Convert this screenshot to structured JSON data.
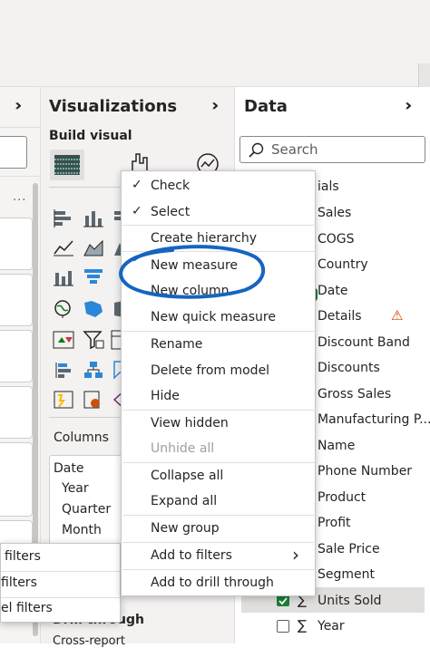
{
  "filters_pane": {
    "collapse_icon": "double-chevron-right-icon",
    "more_label": "...",
    "filter_labels": [
      "filters",
      "filters",
      "el filters"
    ]
  },
  "visualizations": {
    "title": "Visualizations",
    "expand_icon": "double-chevron-right-icon",
    "build_visual_label": "Build visual",
    "columns_label": "Columns",
    "date_field": "Date",
    "date_parts": [
      "Year",
      "Quarter",
      "Month"
    ],
    "drill_through_label": "Drill through",
    "cross_report_label": "Cross-report"
  },
  "data_pane": {
    "title": "Data",
    "expand_icon": "double-chevron-right-icon",
    "search_placeholder": "Search",
    "table_name_partial": "ials",
    "fields": [
      {
        "label": "Sales"
      },
      {
        "label": "COGS"
      },
      {
        "label": "Country"
      },
      {
        "label": "Date"
      },
      {
        "label": "Details",
        "warning": true
      },
      {
        "label": "Discount Band"
      },
      {
        "label": "Discounts"
      },
      {
        "label": "Gross Sales"
      },
      {
        "label": "Manufacturing P..."
      },
      {
        "label": "Name"
      },
      {
        "label": "Phone Number"
      },
      {
        "label": "Product"
      },
      {
        "label": "Profit"
      },
      {
        "label": "Sale Price"
      },
      {
        "label": "Segment"
      },
      {
        "label": "Units Sold",
        "checked": true,
        "sigma": true
      },
      {
        "label": "Year",
        "checked": false,
        "sigma": true
      }
    ],
    "warning_glyph": "⚠",
    "sigma_glyph": "∑"
  },
  "context_menu": {
    "check_glyph": "✓",
    "submenu_glyph": "›",
    "items": [
      "Check",
      "Select",
      "Create hierarchy",
      "New measure",
      "New column",
      "New quick measure",
      "Rename",
      "Delete from model",
      "Hide",
      "View hidden",
      "Unhide all",
      "Collapse all",
      "Expand all",
      "New group",
      "Add to filters",
      "Add to drill through"
    ]
  },
  "annotation": {
    "color": "#1565c0",
    "note": "hand-drawn circle around New measure"
  }
}
